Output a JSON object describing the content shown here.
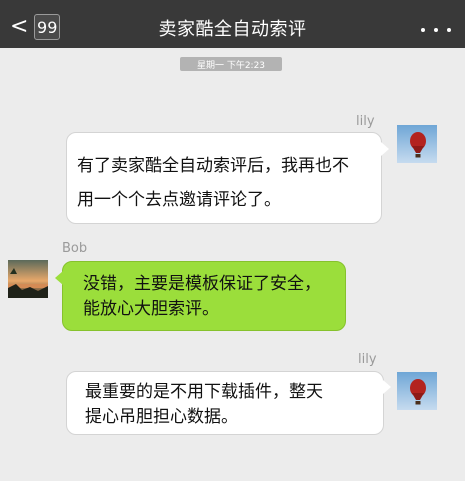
{
  "header": {
    "back_icon": "chevron-left-icon",
    "unread_count": "99",
    "title": "卖家酷全自动索评",
    "more_icon": "more-dots-icon"
  },
  "timestamp": "星期一 下午2:23",
  "messages": [
    {
      "sender": "lily",
      "avatar": "hot-air-balloon-avatar",
      "lines": [
        "有了卖家酷全自动索评后，我再也不",
        "用一个个去点邀请评论了。"
      ]
    },
    {
      "sender": "Bob",
      "avatar": "sunset-landscape-avatar",
      "lines": [
        "没错，主要是模板保证了安全，",
        "能放心大胆索评。"
      ]
    },
    {
      "sender": "lily",
      "avatar": "hot-air-balloon-avatar",
      "lines": [
        "最重要的是不用下载插件，整天",
        "提心吊胆担心数据。"
      ]
    }
  ],
  "colors": {
    "header_bg": "#393939",
    "chat_bg": "#ececec",
    "bubble_incoming": "#ffffff",
    "bubble_outgoing": "#9bde3b"
  }
}
